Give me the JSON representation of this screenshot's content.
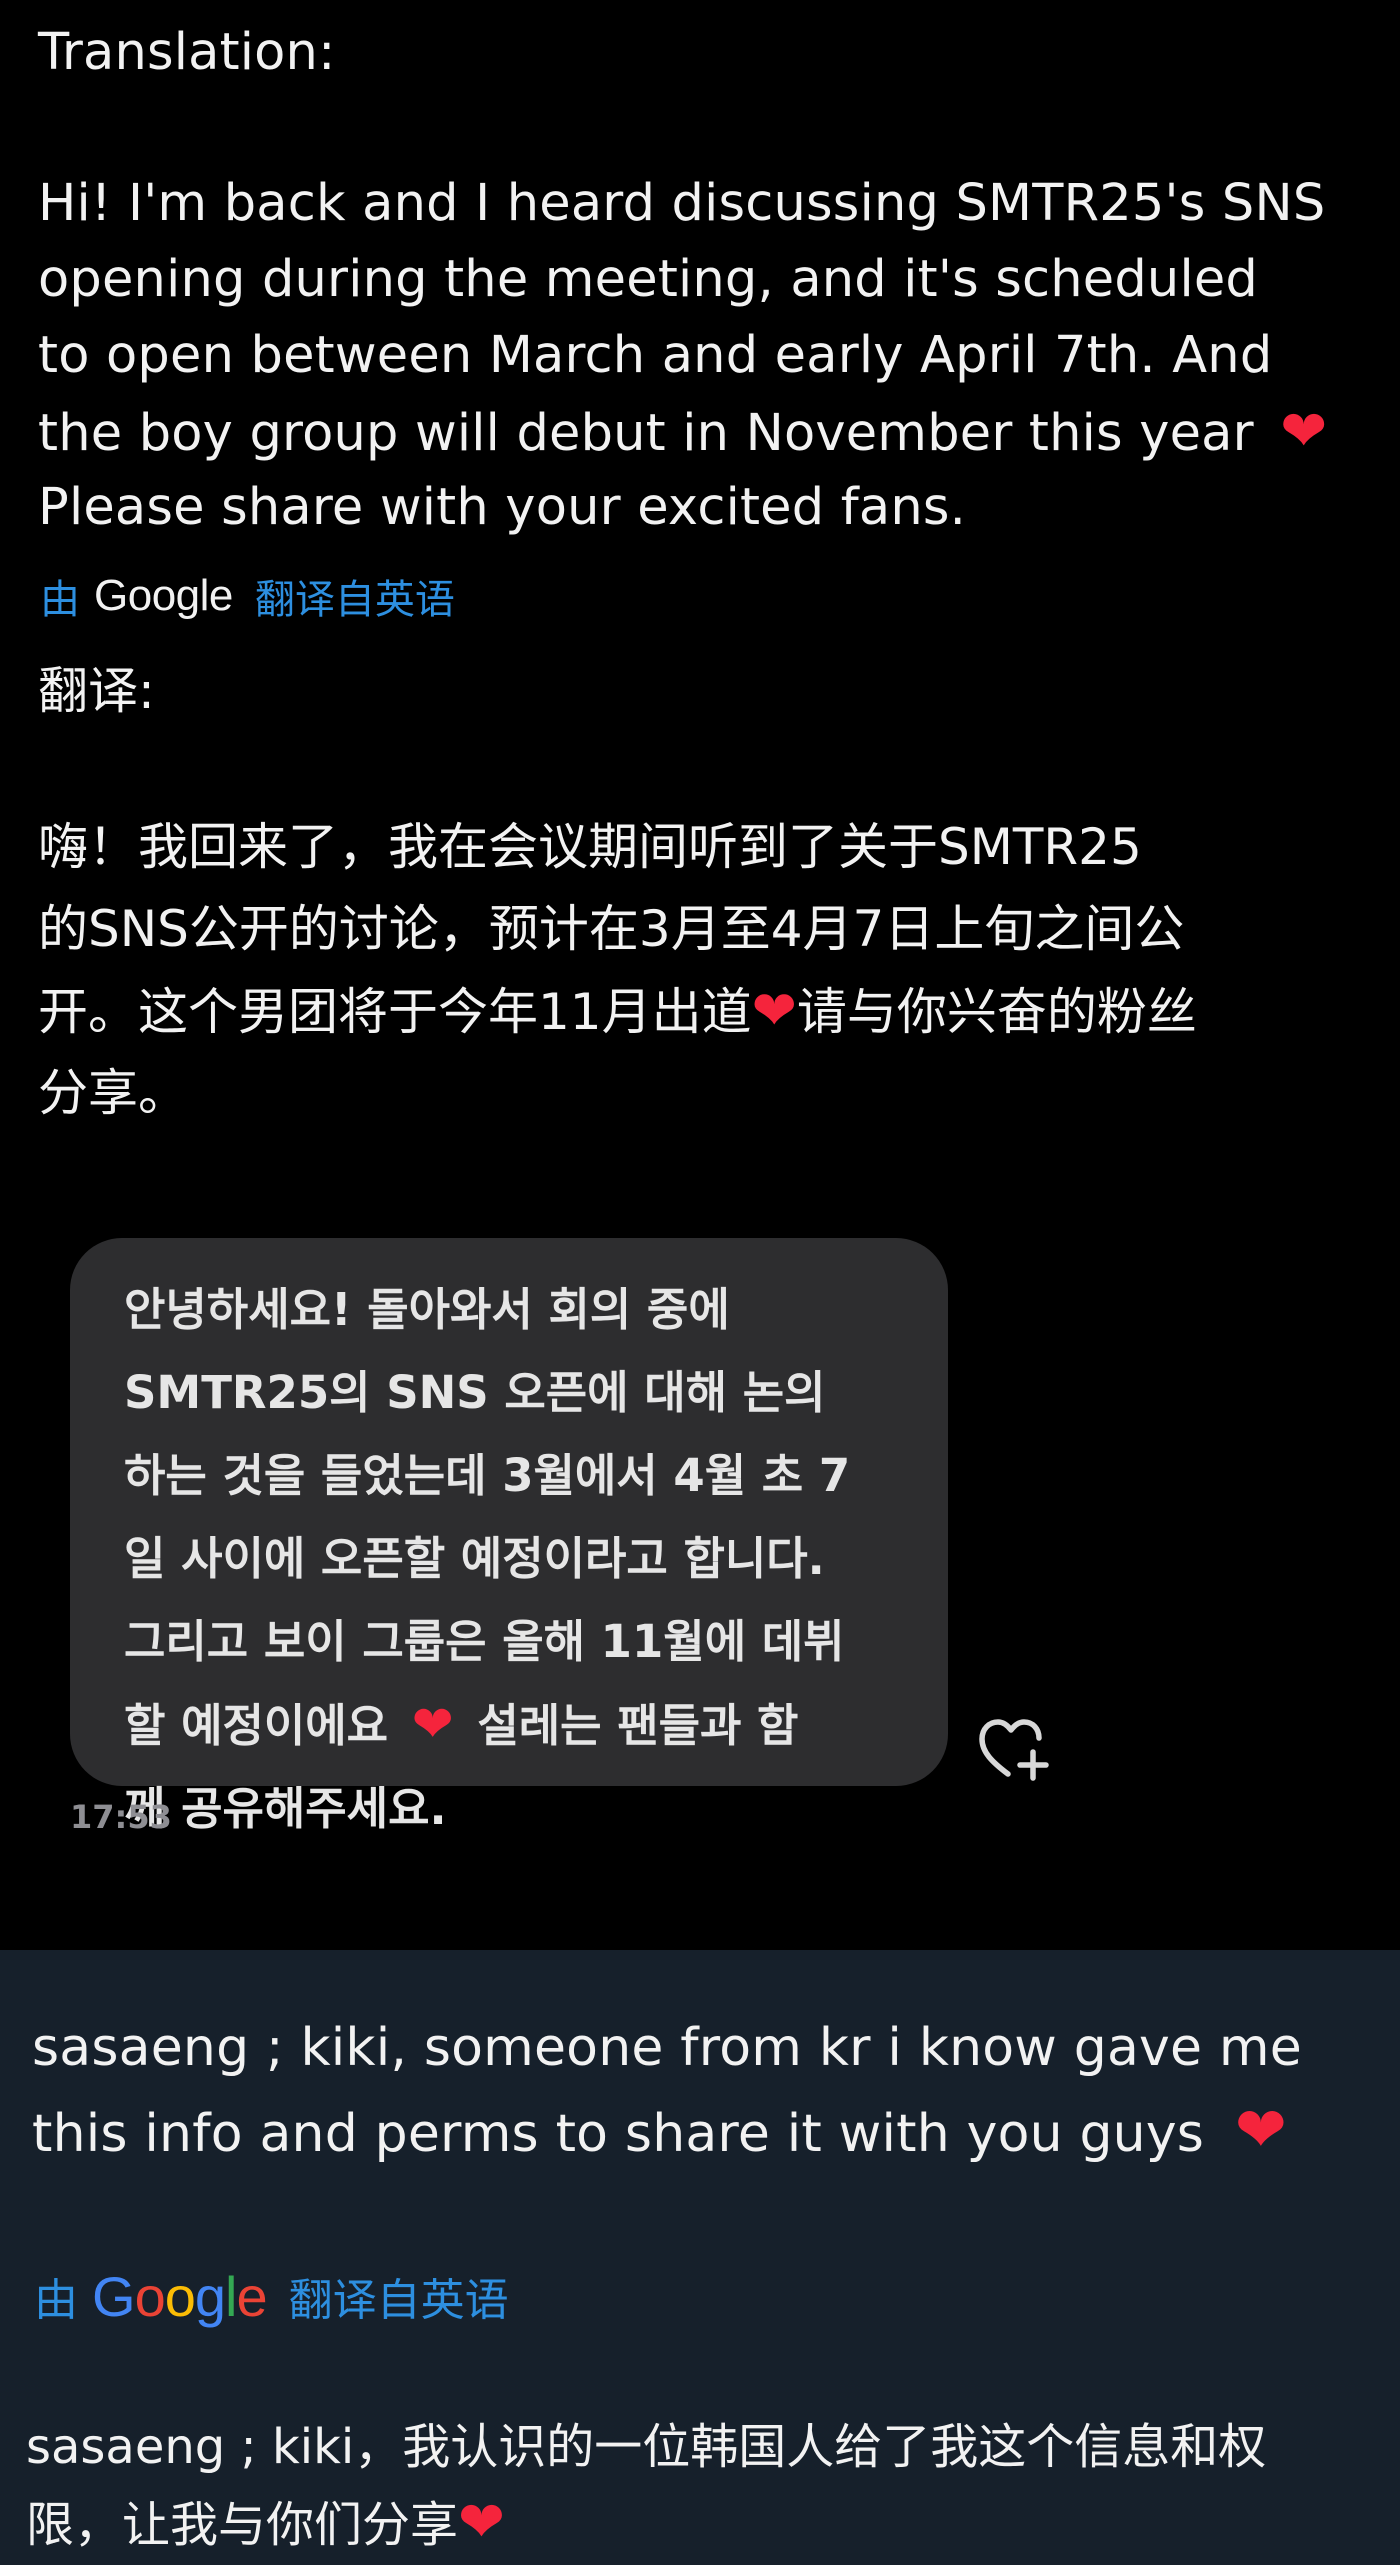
{
  "post": {
    "english": {
      "label": "Translation:",
      "lines": [
        "Hi! I'm back and I heard discussing SMTR25's SNS",
        "opening during the meeting, and it's scheduled",
        "to open between March and early April 7th. And",
        "the boy group will debut in November this year",
        "Please share with your excited fans."
      ],
      "heart": "❤"
    },
    "translated_by": {
      "by": "由",
      "provider": "Google",
      "source": "翻译自英语"
    },
    "chinese": {
      "label": "翻译:",
      "lines": [
        "嗨！我回来了，我在会议期间听到了关于SMTR25",
        "的SNS公开的讨论，预计在3月至4月7日上旬之间公",
        "开。这个男团将于今年11月出道",
        "请与你兴奋的粉丝",
        "分享。"
      ],
      "heart": "❤"
    }
  },
  "message": {
    "lines": [
      "안녕하세요! 돌아와서 회의 중에",
      "SMTR25의 SNS 오픈에 대해 논의",
      "하는 것을 들었는데 3월에서 4월 초 7",
      "일 사이에 오픈할 예정이라고 합니다.",
      "그리고 보이 그룹은 올해 11월에 데뷔",
      "할 예정이에요",
      "설레는 팬들과 함",
      "께 공유해주세요."
    ],
    "heart": "❤",
    "timestamp": "17:53",
    "react_icon": "heart-plus-icon"
  },
  "reply": {
    "english_lines": [
      "sasaeng ; kiki, someone from kr i know gave me",
      "this info and perms to share it with you guys"
    ],
    "heart": "❤",
    "translated_by": {
      "by": "由",
      "provider_letters": [
        "G",
        "o",
        "o",
        "g",
        "l",
        "e"
      ],
      "source": "翻译自英语"
    },
    "chinese_lines": [
      "sasaeng ; kiki，我认识的一位韩国人给了我这个信息和权",
      "限，让我与你们分享"
    ]
  },
  "colors": {
    "background": "#000000",
    "reply_background": "#16202b",
    "link": "#2d8fe0",
    "heart": "#f5243c",
    "bubble": "#2d2d2f",
    "google_blue": "#4285f4",
    "google_red": "#ea4335",
    "google_yellow": "#fbbc05",
    "google_green": "#34a853"
  }
}
